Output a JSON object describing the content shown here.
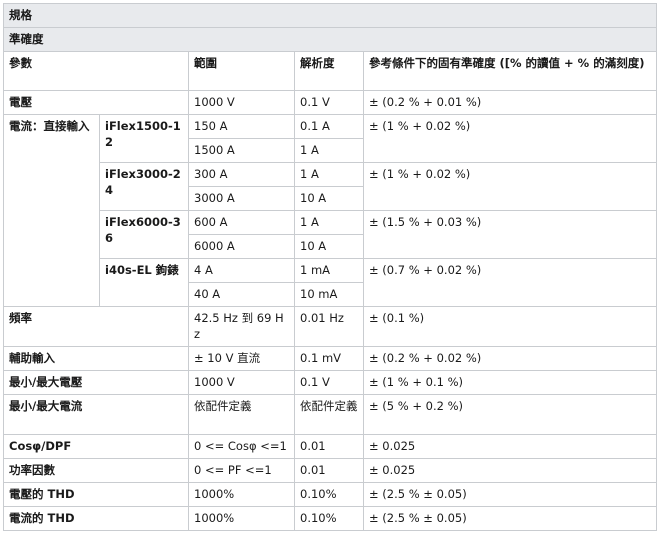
{
  "title": "規格",
  "section": "準確度",
  "headers": {
    "param": "參數",
    "range": "範圍",
    "resolution": "解析度",
    "accuracy": "參考條件下的固有準確度 ([% 的讀值 + % 的滿刻度)"
  },
  "voltage": {
    "param": "電壓",
    "range": "1000 V",
    "resolution": "0.1 V",
    "accuracy": "± (0.2 % + 0.01 %)"
  },
  "current": {
    "param": "電流：直接輸入",
    "probes": [
      {
        "name": "iFlex1500-12",
        "accuracy": "± (1 % + 0.02 %)",
        "rows": [
          {
            "range": "150 A",
            "resolution": "0.1 A"
          },
          {
            "range": "1500 A",
            "resolution": "1 A"
          }
        ]
      },
      {
        "name": "iFlex3000-24",
        "accuracy": "± (1 % + 0.02 %)",
        "rows": [
          {
            "range": "300 A",
            "resolution": "1 A"
          },
          {
            "range": "3000 A",
            "resolution": "10 A"
          }
        ]
      },
      {
        "name": "iFlex6000-36",
        "accuracy": "± (1.5 % + 0.03 %)",
        "rows": [
          {
            "range": "600 A",
            "resolution": "1 A"
          },
          {
            "range": "6000 A",
            "resolution": "10 A"
          }
        ]
      },
      {
        "name": "i40s-EL 鉤錶",
        "accuracy": "± (0.7 % + 0.02 %)",
        "rows": [
          {
            "range": "4 A",
            "resolution": "1 mA"
          },
          {
            "range": "40 A",
            "resolution": "10 mA"
          }
        ]
      }
    ]
  },
  "rows": [
    {
      "param": "頻率",
      "range": "42.5 Hz 到 69 Hz",
      "resolution": "0.01 Hz",
      "accuracy": "± (0.1 %)"
    },
    {
      "param": "輔助輸入",
      "range": "± 10 V 直流",
      "resolution": "0.1 mV",
      "accuracy": "± (0.2 % + 0.02 %)"
    },
    {
      "param": "最小/最大電壓",
      "range": "1000 V",
      "resolution": "0.1 V",
      "accuracy": "± (1 % + 0.1 %)"
    },
    {
      "param": "最小/最大電流",
      "range": "依配件定義",
      "resolution": "依配件定義",
      "accuracy": "± (5 % + 0.2 %)"
    },
    {
      "param": "Cosφ/DPF",
      "range": "0 <= Cosφ <=1",
      "resolution": "0.01",
      "accuracy": "± 0.025"
    },
    {
      "param": "功率因數",
      "range": "0 <= PF <=1",
      "resolution": "0.01",
      "accuracy": "± 0.025"
    },
    {
      "param": "電壓的 THD",
      "range": "1000%",
      "resolution": "0.10%",
      "accuracy": "± (2.5 % ± 0.05)"
    },
    {
      "param": "電流的 THD",
      "range": "1000%",
      "resolution": "0.10%",
      "accuracy": "± (2.5 % ± 0.05)"
    }
  ]
}
